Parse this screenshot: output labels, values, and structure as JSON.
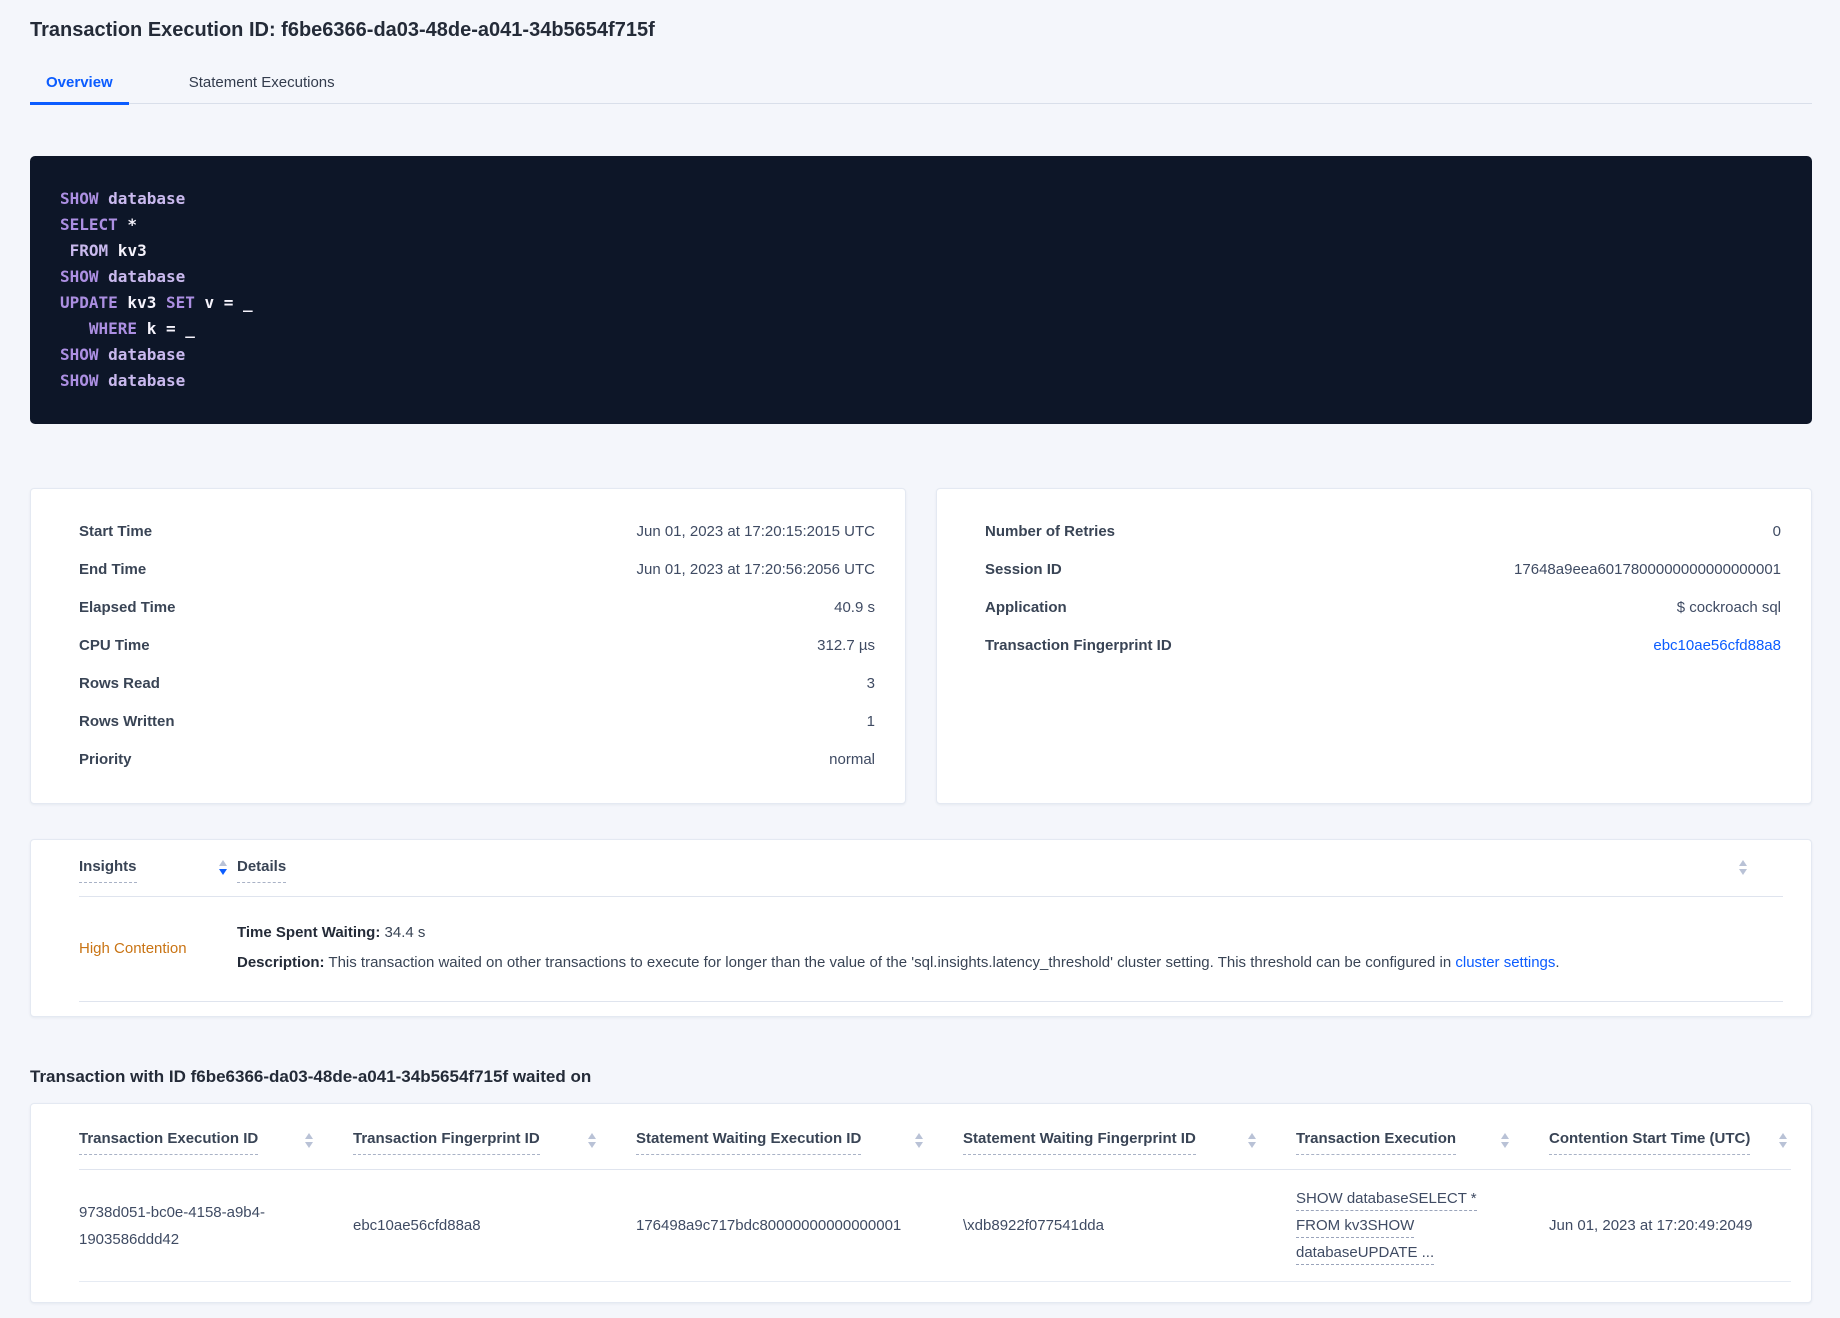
{
  "colors": {
    "accent_blue": "#0b5cff",
    "insight_orange": "#c97414",
    "sql_background": "#0d1628",
    "sql_keyword": "#ac8fe2",
    "sql_identifier": "#f5f3fc"
  },
  "header": {
    "title": "Transaction Execution ID: f6be6366-da03-48de-a041-34b5654f715f",
    "tabs": [
      {
        "label": "Overview",
        "active": true
      },
      {
        "label": "Statement Executions",
        "active": false
      }
    ]
  },
  "sql": {
    "lines": [
      [
        [
          "kw",
          "SHOW"
        ],
        [
          "kw2",
          " database"
        ]
      ],
      [
        [
          "kw",
          "SELECT"
        ],
        [
          "id",
          " *"
        ]
      ],
      [
        [
          "kw2",
          " FROM"
        ],
        [
          "id",
          " kv3"
        ]
      ],
      [
        [
          "kw",
          "SHOW"
        ],
        [
          "kw2",
          " database"
        ]
      ],
      [
        [
          "kw",
          "UPDATE"
        ],
        [
          "id",
          " kv3"
        ],
        [
          "kw",
          " SET"
        ],
        [
          "id",
          " v = _"
        ]
      ],
      [
        [
          "kw",
          "   WHERE"
        ],
        [
          "id",
          " k = _"
        ]
      ],
      [
        [
          "kw",
          "SHOW"
        ],
        [
          "kw2",
          " database"
        ]
      ],
      [
        [
          "kw",
          "SHOW"
        ],
        [
          "kw2",
          " database"
        ]
      ]
    ]
  },
  "summary_left": {
    "rows": [
      {
        "label": "Start Time",
        "value": "Jun 01, 2023 at 17:20:15:2015 UTC"
      },
      {
        "label": "End Time",
        "value": "Jun 01, 2023 at 17:20:56:2056 UTC"
      },
      {
        "label": "Elapsed Time",
        "value": "40.9 s"
      },
      {
        "label": "CPU Time",
        "value": "312.7 µs"
      },
      {
        "label": "Rows Read",
        "value": "3"
      },
      {
        "label": "Rows Written",
        "value": "1"
      },
      {
        "label": "Priority",
        "value": "normal"
      }
    ]
  },
  "summary_right": {
    "rows": [
      {
        "label": "Number of Retries",
        "value": "0"
      },
      {
        "label": "Session ID",
        "value": "17648a9eea6017800000000000000001"
      },
      {
        "label": "Application",
        "value": "$ cockroach sql"
      },
      {
        "label": "Transaction Fingerprint ID",
        "value": "ebc10ae56cfd88a8",
        "link": true
      }
    ]
  },
  "insights": {
    "insights_column": "Insights",
    "details_column": "Details",
    "row": {
      "insight": "High Contention",
      "waiting_label": "Time Spent Waiting:",
      "waiting_value": " 34.4 s",
      "description_label": "Description:",
      "description_text": " This transaction waited on other transactions to execute for longer than the value of the 'sql.insights.latency_threshold' cluster setting. This threshold can be configured in ",
      "description_link": "cluster settings",
      "description_suffix": "."
    }
  },
  "waited_on": {
    "heading": "Transaction with ID f6be6366-da03-48de-a041-34b5654f715f waited on",
    "columns": [
      "Transaction Execution ID",
      "Transaction Fingerprint ID",
      "Statement Waiting Execution ID",
      "Statement Waiting Fingerprint ID",
      "Transaction Execution",
      "Contention Start Time (UTC)"
    ],
    "row": {
      "transaction_execution_id": "9738d051-bc0e-4158-a9b4-1903586ddd42",
      "transaction_fingerprint_id": "ebc10ae56cfd88a8",
      "statement_waiting_execution_id": "176498a9c717bdc80000000000000001",
      "statement_waiting_fingerprint_id": "\\xdb8922f077541dda",
      "transaction_execution_lines": [
        "SHOW databaseSELECT *",
        "FROM kv3SHOW",
        "databaseUPDATE ..."
      ],
      "contention_start_time": "Jun 01, 2023 at 17:20:49:2049"
    }
  }
}
